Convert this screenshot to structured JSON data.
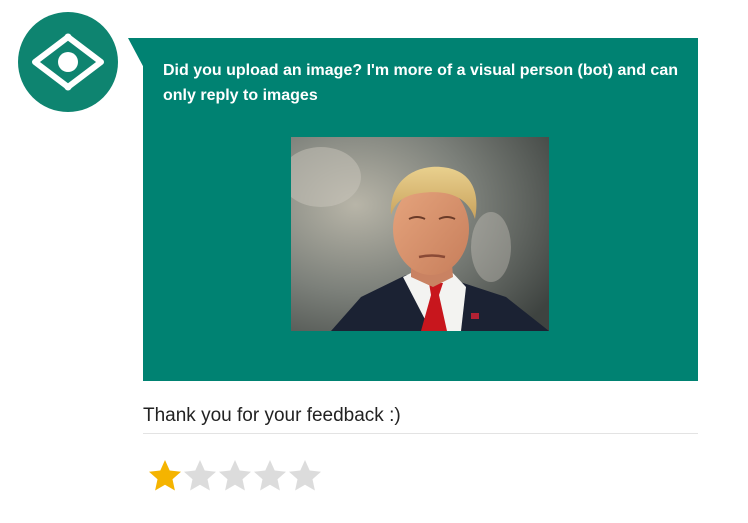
{
  "bot": {
    "avatar_icon": "eye-icon",
    "avatar_color": "#0e8470"
  },
  "message": {
    "text": "Did you upload an image? I'm more of a visual person (bot) and can only reply to images",
    "bubble_color": "#008272",
    "image_subject": "portrait photo of a man in a dark suit, white shirt and red tie"
  },
  "feedback": {
    "text": "Thank you for your feedback :)"
  },
  "rating": {
    "value": 1,
    "max": 5,
    "filled_color": "#f5b400",
    "empty_color": "#dcdcdc"
  }
}
